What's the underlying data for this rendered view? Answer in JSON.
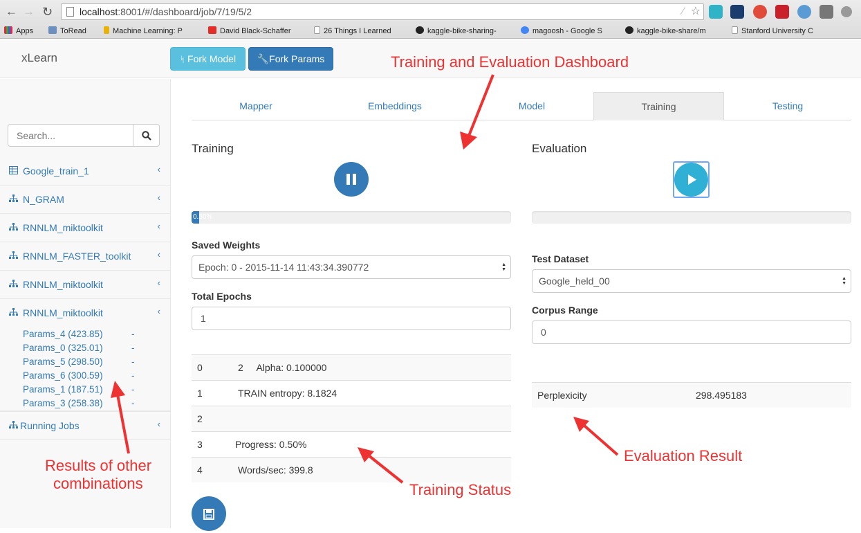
{
  "browser": {
    "url_host": "localhost",
    "url_path": ":8001/#/dashboard/job/7/19/5/2",
    "bookmarks": [
      "Apps",
      "ToRead",
      "Machine Learning: P",
      "David Black-Schaffer",
      "26 Things I Learned",
      "kaggle-bike-sharing-",
      "magoosh - Google S",
      "kaggle-bike-share/m",
      "Stanford University C"
    ]
  },
  "header": {
    "brand": "xLearn",
    "fork_model": "Fork Model",
    "fork_params": "Fork Params"
  },
  "sidebar": {
    "search_placeholder": "Search...",
    "items": [
      {
        "label": "Google_train_1",
        "icon": "table-icon"
      },
      {
        "label": "N_GRAM",
        "icon": "sitemap-icon"
      },
      {
        "label": "RNNLM_miktoolkit",
        "icon": "sitemap-icon"
      },
      {
        "label": "RNNLM_FASTER_toolkit",
        "icon": "sitemap-icon"
      },
      {
        "label": "RNNLM_miktoolkit",
        "icon": "sitemap-icon"
      },
      {
        "label": "RNNLM_miktoolkit",
        "icon": "sitemap-icon"
      }
    ],
    "params": [
      {
        "label": "Params_4 (423.85)",
        "mark": "-"
      },
      {
        "label": "Params_0 (325.01)",
        "mark": "-"
      },
      {
        "label": "Params_5 (298.50)",
        "mark": "-"
      },
      {
        "label": "Params_6 (300.59)",
        "mark": "-"
      },
      {
        "label": "Params_1 (187.51)",
        "mark": "-"
      },
      {
        "label": "Params_3 (258.38)",
        "mark": "-"
      }
    ],
    "running_jobs": "Running Jobs"
  },
  "tabs": [
    "Mapper",
    "Embeddings",
    "Model",
    "Training",
    "Testing"
  ],
  "training": {
    "title": "Training",
    "progress_text": "0.50%",
    "progress_value": 0.005,
    "saved_weights_label": "Saved Weights",
    "saved_weights_value": "Epoch: 0 - 2015-11-14 11:43:34.390772",
    "total_epochs_label": "Total Epochs",
    "total_epochs_value": "1",
    "log": [
      {
        "n": "0",
        "text": "2     Alpha: 0.100000"
      },
      {
        "n": "1",
        "text": "TRAIN entropy: 8.1824"
      },
      {
        "n": "2",
        "text": ""
      },
      {
        "n": "3",
        "text": "Progress: 0.50%"
      },
      {
        "n": "4",
        "text": "Words/sec: 399.8"
      }
    ]
  },
  "evaluation": {
    "title": "Evaluation",
    "test_dataset_label": "Test Dataset",
    "test_dataset_value": "Google_held_00",
    "corpus_range_label": "Corpus Range",
    "corpus_range_value": "0",
    "result_label": "Perplexicity",
    "result_value": "298.495183"
  },
  "annotations": {
    "dashboard": "Training and Evaluation Dashboard",
    "other_results_line1": "Results of other",
    "other_results_line2": "combinations",
    "training_status": "Training Status",
    "evaluation_result": "Evaluation Result"
  },
  "colors": {
    "primary": "#337ab7",
    "info": "#5bc0de",
    "annotation": "#ee3232"
  }
}
